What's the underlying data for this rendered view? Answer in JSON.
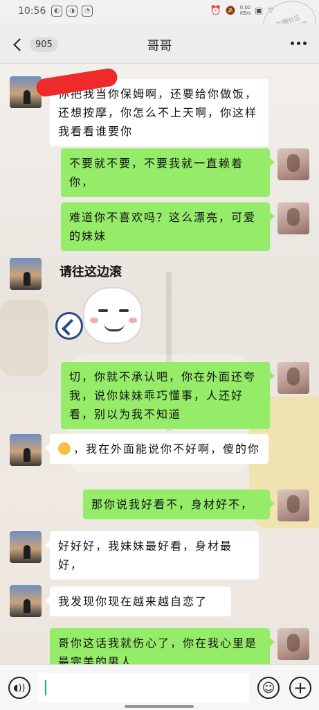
{
  "status_bar": {
    "time": "10:56",
    "net_speed": "0.00\nKB/s",
    "watermark": "加趣社区\nhaijieo.com"
  },
  "header": {
    "unread_count": "905",
    "title": "哥哥"
  },
  "messages": [
    {
      "side": "left",
      "sender": "brother",
      "text": "你把我当你保姆啊，还要给你做饭，还想按摩，你怎么不上天啊，你这样我看看谁要你"
    },
    {
      "side": "right",
      "sender": "sister",
      "text": "不要就不要，不要我就一直赖着你，"
    },
    {
      "side": "right",
      "sender": "sister",
      "text": "难道你不喜欢吗？这么漂亮，可爱的妹妹"
    },
    {
      "side": "left",
      "sender": "brother",
      "type": "sticker",
      "text": "请往这边滚"
    },
    {
      "side": "right",
      "sender": "sister",
      "text": "切，你就不承认吧，你在外面还夸我，说你妹妹乖巧懂事，人还好看，别以为我不知道"
    },
    {
      "side": "left",
      "sender": "brother",
      "text": "，我在外面能说你不好啊，傻的你",
      "emoji": "laugh-cry-emoji"
    },
    {
      "side": "right",
      "sender": "sister",
      "text": "那你说我好看不，身材好不，"
    },
    {
      "side": "left",
      "sender": "brother",
      "text": "好好好，我妹妹最好看，身材最好，"
    },
    {
      "side": "left",
      "sender": "brother",
      "text": "我发现你现在越来越自恋了"
    },
    {
      "side": "right",
      "sender": "sister",
      "text": "哥你这话我就伤心了，你在我心里是最完美的男人"
    }
  ],
  "input": {
    "value": "",
    "placeholder": ""
  },
  "colors": {
    "sent_bubble": "#95ec69",
    "received_bubble": "#ffffff",
    "redaction": "#ef2a2a"
  }
}
